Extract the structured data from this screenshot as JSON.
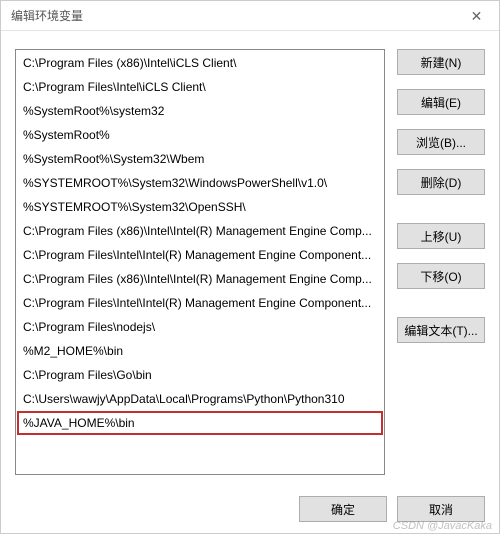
{
  "window": {
    "title": "编辑环境变量",
    "close_label": "✕"
  },
  "list": {
    "items": [
      "C:\\Program Files (x86)\\Intel\\iCLS Client\\",
      "C:\\Program Files\\Intel\\iCLS Client\\",
      "%SystemRoot%\\system32",
      "%SystemRoot%",
      "%SystemRoot%\\System32\\Wbem",
      "%SYSTEMROOT%\\System32\\WindowsPowerShell\\v1.0\\",
      "%SYSTEMROOT%\\System32\\OpenSSH\\",
      "C:\\Program Files (x86)\\Intel\\Intel(R) Management Engine Comp...",
      "C:\\Program Files\\Intel\\Intel(R) Management Engine Component...",
      "C:\\Program Files (x86)\\Intel\\Intel(R) Management Engine Comp...",
      "C:\\Program Files\\Intel\\Intel(R) Management Engine Component...",
      "C:\\Program Files\\nodejs\\",
      "%M2_HOME%\\bin",
      "C:\\Program Files\\Go\\bin",
      "C:\\Users\\wawjy\\AppData\\Local\\Programs\\Python\\Python310",
      "%JAVA_HOME%\\bin"
    ],
    "highlighted_index": 15
  },
  "buttons": {
    "new": "新建(N)",
    "edit": "编辑(E)",
    "browse": "浏览(B)...",
    "delete": "删除(D)",
    "move_up": "上移(U)",
    "move_down": "下移(O)",
    "edit_text": "编辑文本(T)...",
    "ok": "确定",
    "cancel": "取消"
  },
  "watermark": "CSDN @JavacKaka"
}
